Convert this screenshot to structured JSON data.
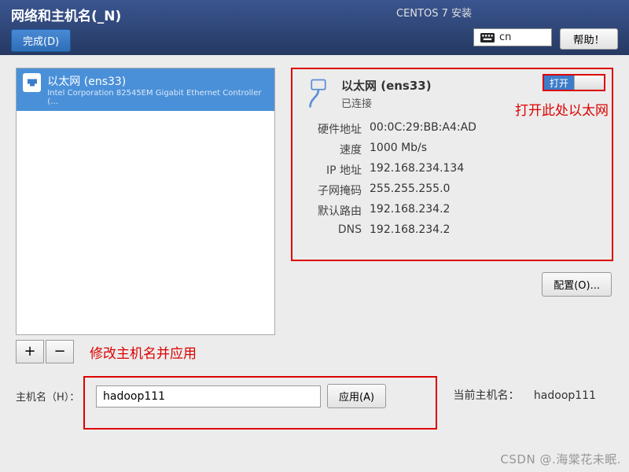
{
  "header": {
    "title": "网络和主机名(_N)",
    "installer": "CENTOS 7 安装",
    "done_label": "完成(D)",
    "lang": "cn",
    "help_label": "帮助！"
  },
  "nic_list": {
    "item": {
      "title": "以太网 (ens33)",
      "subtitle": "Intel Corporation 82545EM Gigabit Ethernet Controller (…"
    },
    "add_label": "+",
    "remove_label": "−"
  },
  "annotations": {
    "modify_hostname": "修改主机名并应用",
    "open_ethernet": "打开此处以太网"
  },
  "detail": {
    "title": "以太网 (ens33)",
    "status": "已连接",
    "toggle_on": "打开",
    "rows": {
      "hwaddr_k": "硬件地址",
      "hwaddr_v": "00:0C:29:BB:A4:AD",
      "speed_k": "速度",
      "speed_v": "1000 Mb/s",
      "ip_k": "IP 地址",
      "ip_v": "192.168.234.134",
      "mask_k": "子网掩码",
      "mask_v": "255.255.255.0",
      "route_k": "默认路由",
      "route_v": "192.168.234.2",
      "dns_k": "DNS",
      "dns_v": "192.168.234.2"
    },
    "configure_label": "配置(O)..."
  },
  "hostname": {
    "label": "主机名（H）：",
    "value": "hadoop111",
    "apply_label": "应用(A)",
    "current_label": "当前主机名：",
    "current_value": "hadoop111"
  },
  "watermark": "CSDN @.海棠花未眠."
}
